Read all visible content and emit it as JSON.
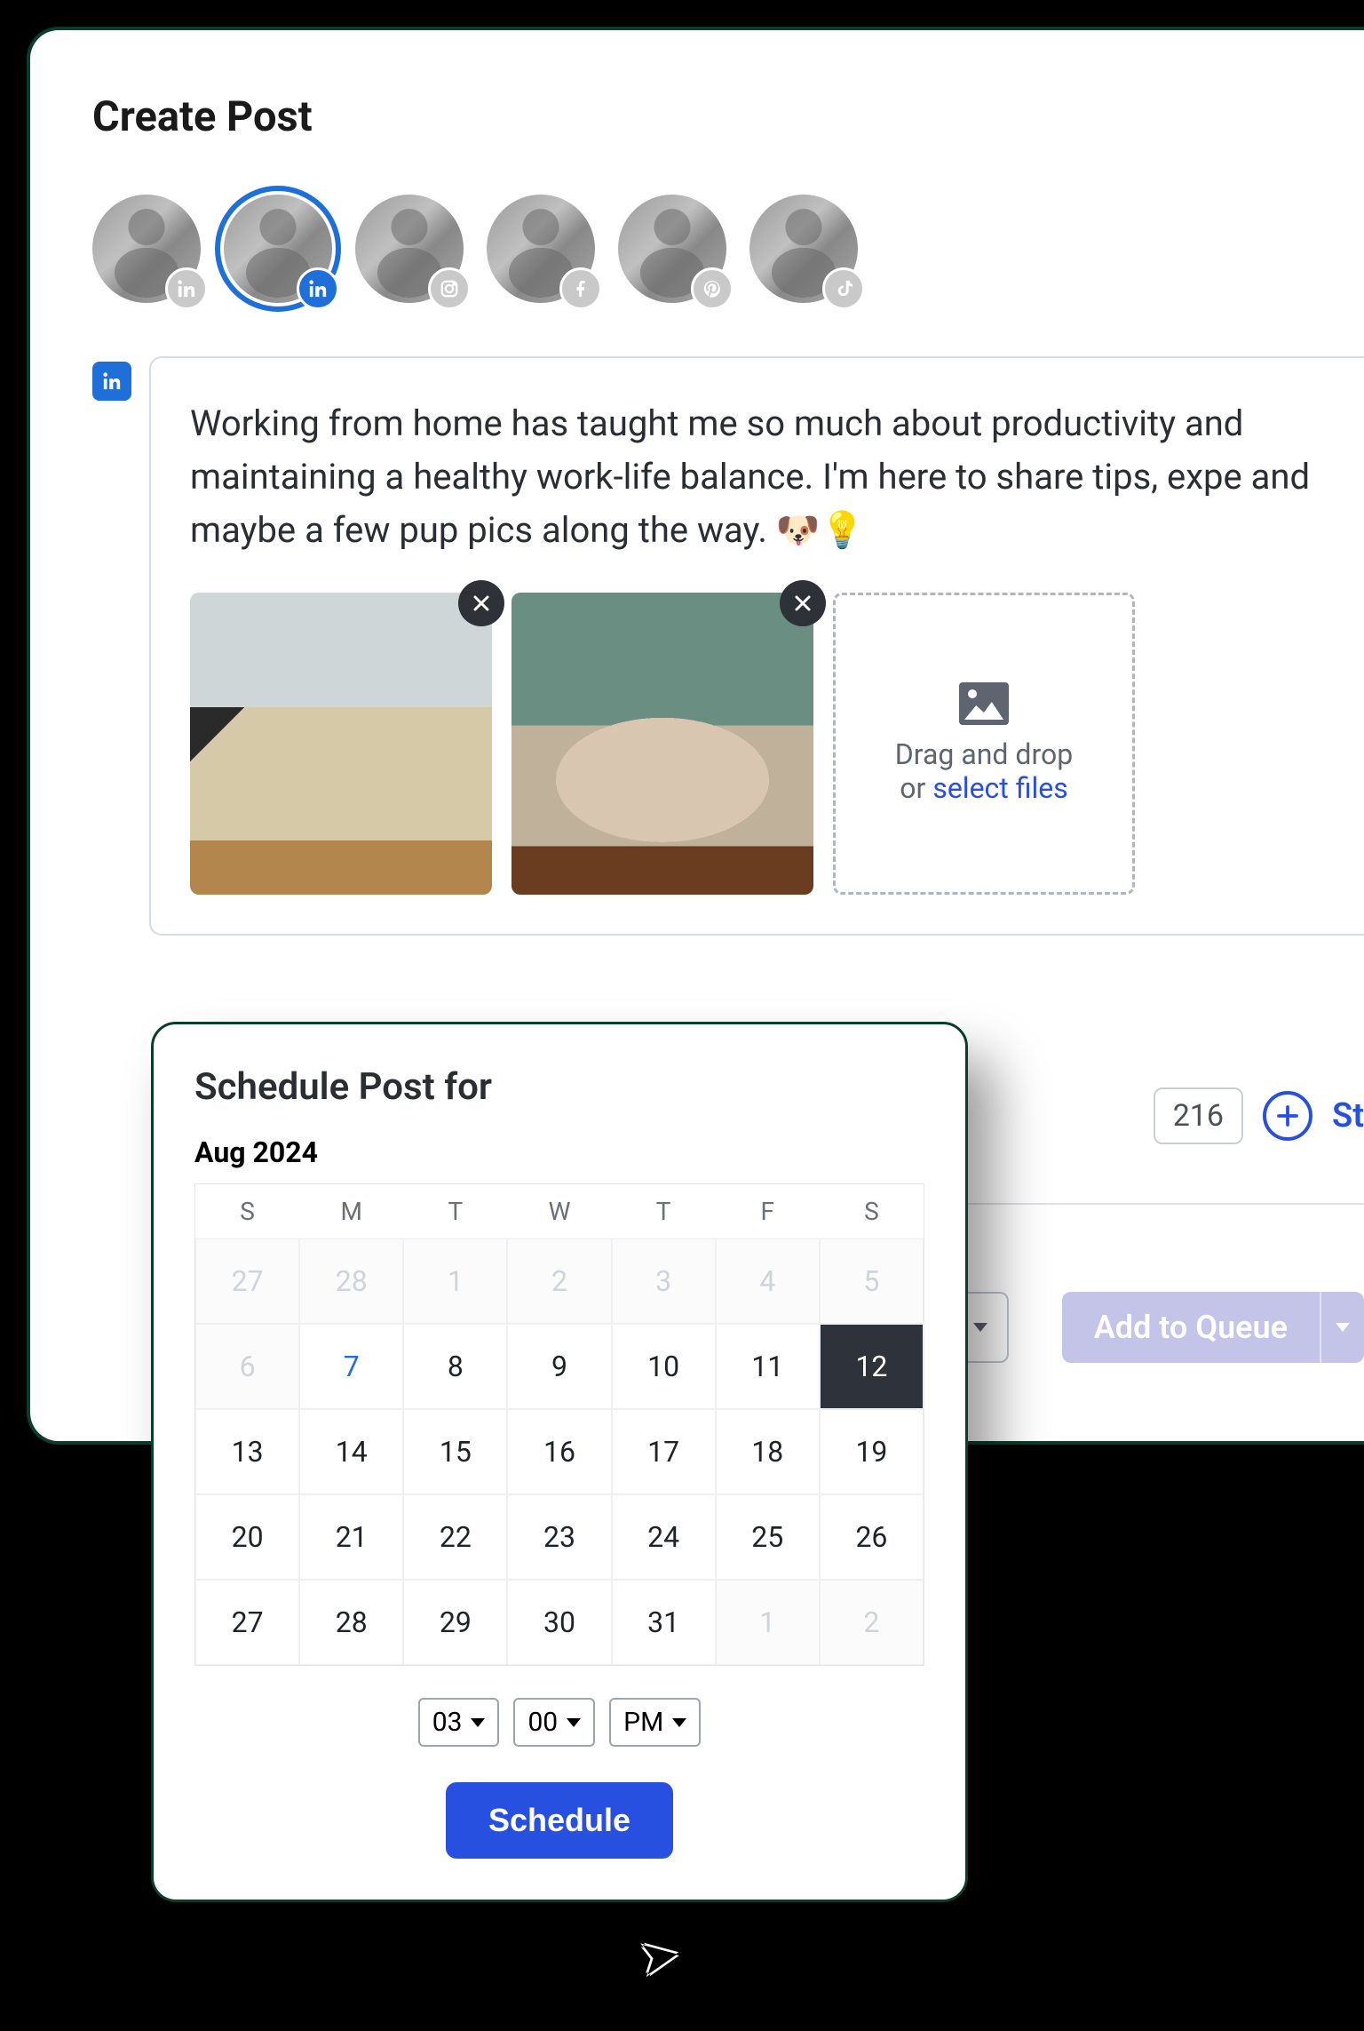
{
  "title": "Create Post",
  "accounts": [
    {
      "platform": "linkedin",
      "selected": false
    },
    {
      "platform": "linkedin",
      "selected": true
    },
    {
      "platform": "instagram",
      "selected": false
    },
    {
      "platform": "facebook",
      "selected": false
    },
    {
      "platform": "pinterest",
      "selected": false
    },
    {
      "platform": "tiktok",
      "selected": false
    }
  ],
  "compose": {
    "platform_icon": "linkedin",
    "text": "Working from home has taught me so much about productivity and maintaining a healthy work-life balance. I'm here to share tips, expe and maybe a few pup pics along the way. 🐶💡",
    "dropzone_line1": "Drag and drop",
    "dropzone_or": "or ",
    "dropzone_link": "select files"
  },
  "toolbar": {
    "char_count": "216",
    "start_label": "St"
  },
  "actions": {
    "queue_label": "Add to Queue"
  },
  "scheduler": {
    "title": "Schedule Post for",
    "month": "Aug 2024",
    "weekdays": [
      "S",
      "M",
      "T",
      "W",
      "T",
      "F",
      "S"
    ],
    "grid": [
      [
        {
          "d": "27",
          "muted": true
        },
        {
          "d": "28",
          "muted": true
        },
        {
          "d": "1",
          "muted": true
        },
        {
          "d": "2",
          "muted": true
        },
        {
          "d": "3",
          "muted": true
        },
        {
          "d": "4",
          "muted": true
        },
        {
          "d": "5",
          "muted": true
        }
      ],
      [
        {
          "d": "6",
          "muted": true
        },
        {
          "d": "7",
          "today": true
        },
        {
          "d": "8"
        },
        {
          "d": "9"
        },
        {
          "d": "10"
        },
        {
          "d": "11"
        },
        {
          "d": "12",
          "selected": true
        }
      ],
      [
        {
          "d": "13"
        },
        {
          "d": "14"
        },
        {
          "d": "15"
        },
        {
          "d": "16"
        },
        {
          "d": "17"
        },
        {
          "d": "18"
        },
        {
          "d": "19"
        }
      ],
      [
        {
          "d": "20"
        },
        {
          "d": "21"
        },
        {
          "d": "22"
        },
        {
          "d": "23"
        },
        {
          "d": "24"
        },
        {
          "d": "25"
        },
        {
          "d": "26"
        }
      ],
      [
        {
          "d": "27"
        },
        {
          "d": "28"
        },
        {
          "d": "29"
        },
        {
          "d": "30"
        },
        {
          "d": "31"
        },
        {
          "d": "1",
          "muted": true
        },
        {
          "d": "2",
          "muted": true
        }
      ]
    ],
    "hour": "03",
    "minute": "00",
    "ampm": "PM",
    "button": "Schedule"
  }
}
